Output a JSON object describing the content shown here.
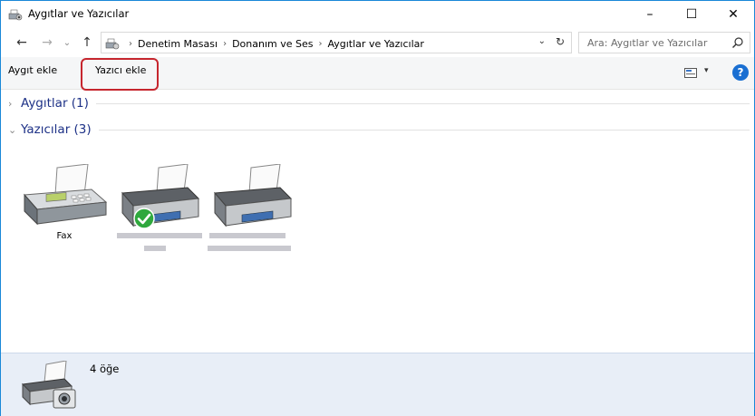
{
  "window": {
    "title": "Aygıtlar ve Yazıcılar",
    "controls": {
      "minimize": "–",
      "maximize": "☐",
      "close": "✕"
    }
  },
  "nav": {
    "back": "←",
    "forward": "→",
    "recent": "⌄",
    "up": "↑"
  },
  "address": {
    "breadcrumbs": [
      "Denetim Masası",
      "Donanım ve Ses",
      "Aygıtlar ve Yazıcılar"
    ],
    "separator": "›"
  },
  "search": {
    "placeholder": "Ara: Aygıtlar ve Yazıcılar",
    "value": ""
  },
  "toolbar": {
    "add_device": "Aygıt ekle",
    "add_printer": "Yazıcı ekle",
    "view_dropdown": "▾",
    "help": "?"
  },
  "groups": [
    {
      "label": "Aygıtlar (1)",
      "expanded": false,
      "chevron": "›"
    },
    {
      "label": "Yazıcılar (3)",
      "expanded": true,
      "chevron": "⌄"
    }
  ],
  "printers": [
    {
      "label": "Fax",
      "icon": "fax-icon",
      "default": false
    },
    {
      "label": "",
      "icon": "printer-icon",
      "default": true
    },
    {
      "label": "",
      "icon": "printer-icon",
      "default": false
    }
  ],
  "details": {
    "count": "4 öğe",
    "icon": "devices-printers-icon"
  },
  "colors": {
    "accent": "#1a88d8",
    "group_label": "#1e3287",
    "highlight": "#c6262e",
    "default_check": "#2fa83d",
    "details_bg": "#e8eef7"
  }
}
